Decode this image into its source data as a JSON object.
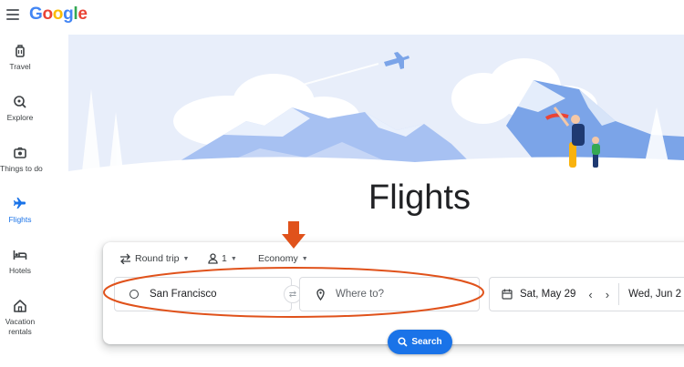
{
  "header": {
    "logo_letters": [
      {
        "ch": "G",
        "color": "#4285f4"
      },
      {
        "ch": "o",
        "color": "#ea4335"
      },
      {
        "ch": "o",
        "color": "#fbbc05"
      },
      {
        "ch": "g",
        "color": "#4285f4"
      },
      {
        "ch": "l",
        "color": "#34a853"
      },
      {
        "ch": "e",
        "color": "#ea4335"
      }
    ]
  },
  "sidebar": {
    "items": [
      {
        "label": "Travel",
        "icon": "luggage-icon",
        "active": false
      },
      {
        "label": "Explore",
        "icon": "explore-icon",
        "active": false
      },
      {
        "label": "Things to do",
        "icon": "camera-icon",
        "active": false
      },
      {
        "label": "Flights",
        "icon": "plane-icon",
        "active": true
      },
      {
        "label": "Hotels",
        "icon": "bed-icon",
        "active": false
      },
      {
        "label": "Vacation rentals",
        "label_line1": "Vacation",
        "label_line2": "rentals",
        "icon": "house-icon",
        "active": false
      }
    ]
  },
  "page": {
    "title": "Flights"
  },
  "search": {
    "trip_type": "Round trip",
    "passengers": "1",
    "cabin_class": "Economy",
    "origin": "San Francisco",
    "destination_placeholder": "Where to?",
    "departure_date": "Sat, May 29",
    "return_date": "Wed, Jun 2",
    "search_label": "Search"
  },
  "colors": {
    "accent": "#1a73e8",
    "annotation": "#e0521b",
    "hero_sky": "#e8eefa"
  }
}
